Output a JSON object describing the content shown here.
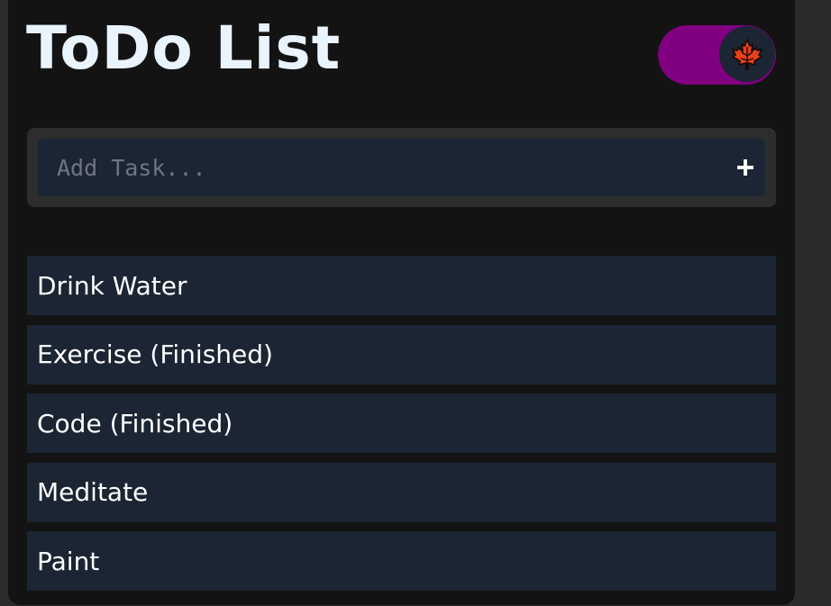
{
  "app": {
    "title": "ToDo List"
  },
  "theme_toggle": {
    "state": "on",
    "track_color": "#800080",
    "knob_icon": "maple-leaf-icon",
    "icon_color": "#e8401c"
  },
  "add_task": {
    "placeholder": "Add Task...",
    "value": "",
    "button_icon": "plus-icon"
  },
  "tasks": [
    {
      "label": "Drink Water"
    },
    {
      "label": "Exercise (Finished)"
    },
    {
      "label": "Code (Finished)"
    },
    {
      "label": "Meditate"
    },
    {
      "label": "Paint"
    }
  ]
}
